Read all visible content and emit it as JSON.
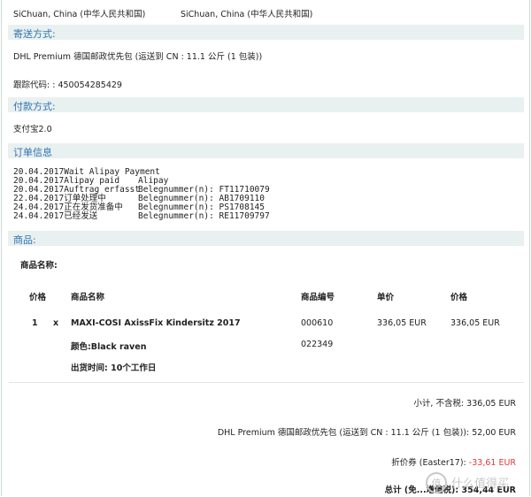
{
  "address": {
    "left": "SiChuan, China (中华人民共和国)",
    "right": "SiChuan, China (中华人民共和国)"
  },
  "shipping": {
    "heading": "寄送方式:",
    "method": "DHL Premium 德国邮政优先包 (运送到 CN : 11.1 公斤 (1 包装))",
    "tracking": "跟踪代码: : 450054285429"
  },
  "payment": {
    "heading": "付款方式:",
    "method": "支付宝2.0"
  },
  "order_info": {
    "heading": "订单信息",
    "history": [
      {
        "date": "20.04.2017",
        "status": "Wait Alipay Payment",
        "ref": ""
      },
      {
        "date": "20.04.2017",
        "status": "Alipay paid",
        "ref": "Alipay"
      },
      {
        "date": "20.04.2017",
        "status": "Auftrag erfasst",
        "ref": "Belegnummer(n): FT11710079"
      },
      {
        "date": "22.04.2017",
        "status": "订单处理中",
        "ref": "Belegnummer(n): AB1709110"
      },
      {
        "date": "24.04.2017",
        "status": "正在发货准备中",
        "ref": "Belegnummer(n): PS1708145"
      },
      {
        "date": "24.04.2017",
        "status": "已经发送",
        "ref": "Belegnummer(n): RE11709797"
      }
    ]
  },
  "products": {
    "heading": "商品:",
    "name_label": "商品名称:",
    "headers": {
      "price": "价格",
      "name": "商品名称",
      "sku": "商品编号",
      "unit": "单价",
      "total": "价格"
    },
    "item": {
      "qty": "1",
      "x": "x",
      "name": "MAXI-COSI AxissFix Kindersitz 2017",
      "sku": "000610",
      "unit": "336,05 EUR",
      "total": "336,05 EUR",
      "color": "颜色:Black raven",
      "color_sku": "022349",
      "ship_time": "出货时间:  10个工作日"
    }
  },
  "totals": {
    "subtotal": "小计, 不含税: 336,05 EUR",
    "shipping": "DHL Premium 德国邮政优先包 (运送到 CN : 11.1 公斤 (1 包装)): 52,00 EUR",
    "coupon_label": "折价券 (Easter17):",
    "coupon_value": "-33,61 EUR",
    "total": "总计 (免...增值税): 354,44 EUR"
  },
  "watermark": "值 什么值得买",
  "colors": {
    "band": "#e9f0f0",
    "heading": "#2e73b0",
    "discount": "#e03a3a"
  }
}
